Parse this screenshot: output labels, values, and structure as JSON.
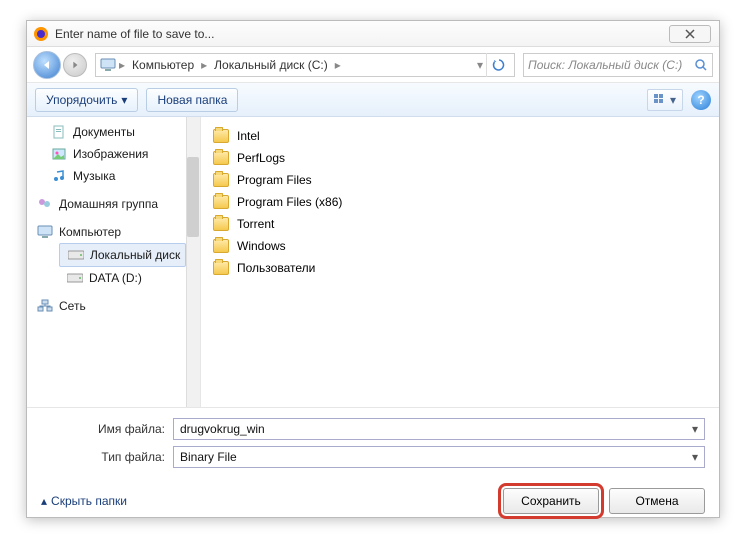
{
  "window": {
    "title": "Enter name of file to save to..."
  },
  "nav": {
    "breadcrumb": [
      "Компьютер",
      "Локальный диск (C:)"
    ],
    "search_placeholder": "Поиск: Локальный диск (С:)"
  },
  "toolbar": {
    "organize": "Упорядочить",
    "new_folder": "Новая папка"
  },
  "tree": {
    "libs": [
      "Документы",
      "Изображения",
      "Музыка"
    ],
    "homegroup": "Домашняя группа",
    "computer": "Компьютер",
    "drives": [
      "Локальный диск",
      "DATA (D:)"
    ],
    "network": "Сеть"
  },
  "files": [
    "Intel",
    "PerfLogs",
    "Program Files",
    "Program Files (x86)",
    "Torrent",
    "Windows",
    "Пользователи"
  ],
  "form": {
    "filename_label": "Имя файла:",
    "filename_value": "drugvokrug_win",
    "filetype_label": "Тип файла:",
    "filetype_value": "Binary File"
  },
  "footer": {
    "hide_folders": "Скрыть папки",
    "save": "Сохранить",
    "cancel": "Отмена"
  }
}
